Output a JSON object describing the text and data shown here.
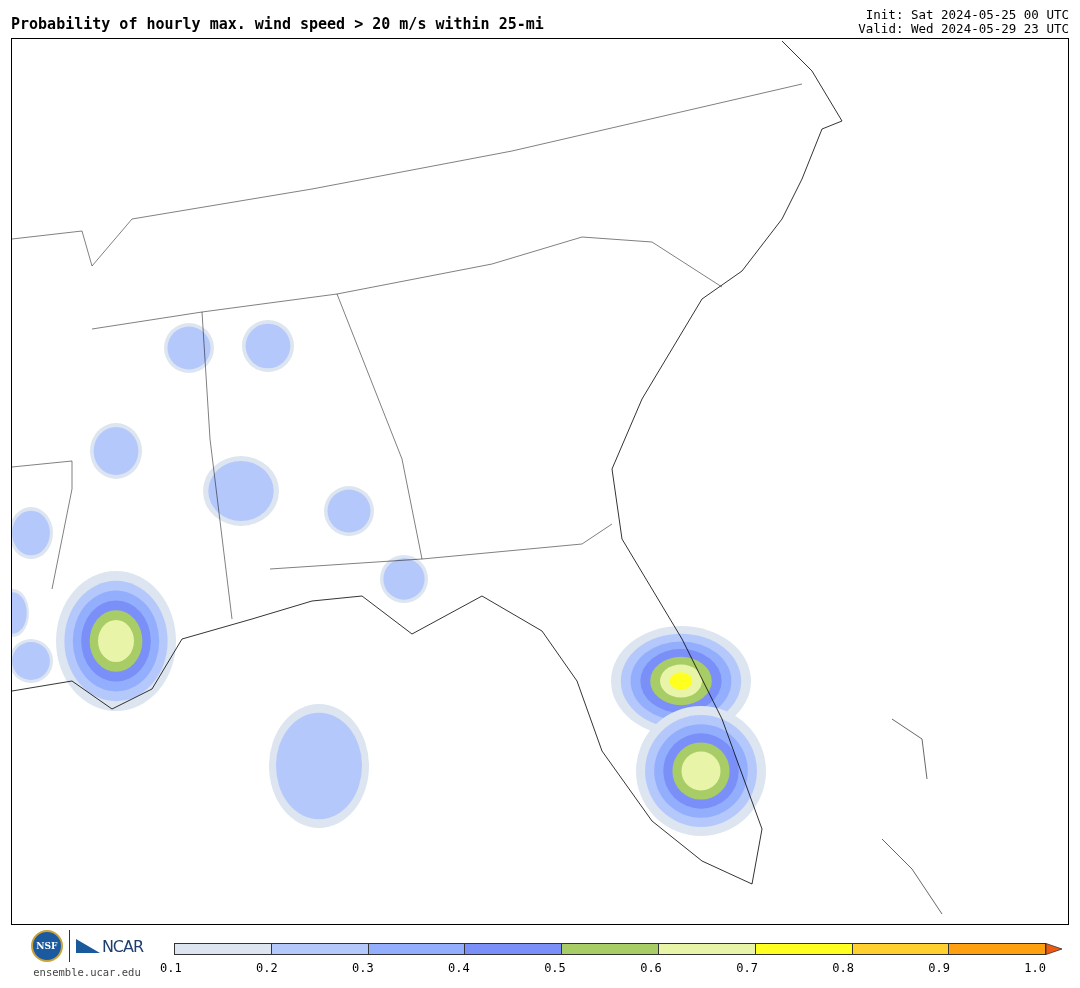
{
  "header": {
    "title": "Probability of hourly max. wind speed > 20 m/s within 25-mi",
    "init": "Init: Sat 2024-05-25 00 UTC",
    "valid": "Valid: Wed 2024-05-29 23 UTC"
  },
  "logos": {
    "nsf": "NSF",
    "ncar": "NCAR",
    "url": "ensemble.ucar.edu"
  },
  "colorbar": {
    "bins": [
      {
        "color": "#dce5f0"
      },
      {
        "color": "#b5c8fb"
      },
      {
        "color": "#93aefc"
      },
      {
        "color": "#7a8ff8"
      },
      {
        "color": "#a8cc66"
      },
      {
        "color": "#e8f5a8"
      },
      {
        "color": "#ffff20"
      },
      {
        "color": "#ffd030"
      },
      {
        "color": "#ffa010"
      }
    ],
    "extend_arrow": {
      "color": "#f05a10"
    },
    "ticks": [
      "0.1",
      "0.2",
      "0.3",
      "0.4",
      "0.5",
      "0.6",
      "0.7",
      "0.8",
      "0.9",
      "1.0"
    ]
  }
}
